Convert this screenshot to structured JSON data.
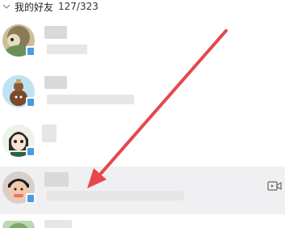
{
  "group": {
    "name": "我的好友",
    "count": "127/323",
    "icon": "chevron-down-icon"
  },
  "friends": [
    {
      "avatar": "avatar-cat-icon",
      "status_icon": "phone-status-icon"
    },
    {
      "avatar": "avatar-gourd-icon",
      "status_icon": "phone-status-icon"
    },
    {
      "avatar": "avatar-anime-girl-icon",
      "status_icon": "phone-status-icon"
    },
    {
      "avatar": "avatar-boy-photo-icon",
      "status_icon": "phone-status-icon",
      "action_icon": "video-chat-icon",
      "highlighted": true
    },
    {
      "avatar": "avatar-partial-icon",
      "status_icon": "phone-status-icon"
    }
  ],
  "colors": {
    "highlight_row": "#f0f0f2",
    "arrow": "#e5484d",
    "status_blue": "#4a9be0"
  }
}
